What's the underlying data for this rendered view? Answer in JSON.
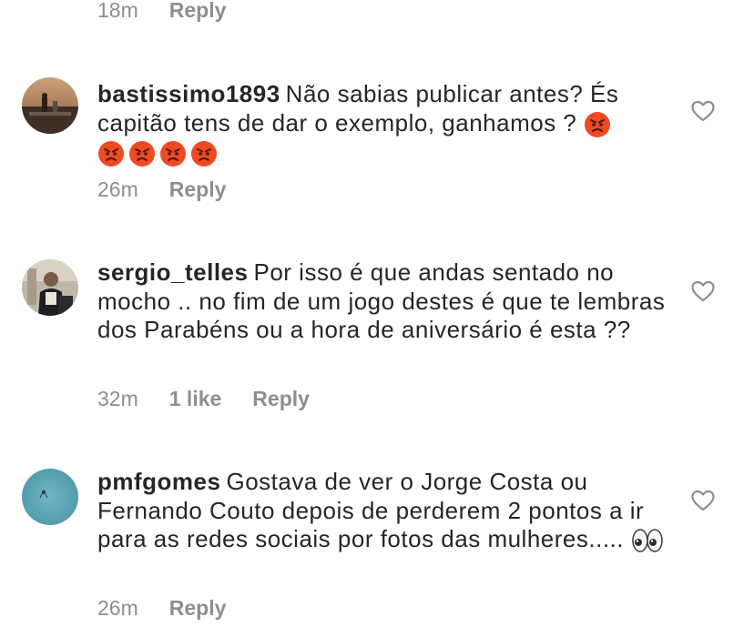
{
  "top_meta": {
    "time": "18m",
    "reply": "Reply"
  },
  "comments": [
    {
      "username": "bastissimo1893",
      "text": "Não sabias publicar antes? És capitão tens de dar o exemplo, ganhamos ?",
      "emojis": [
        "angry-face",
        "angry-face",
        "angry-face",
        "angry-face",
        "angry-face"
      ],
      "time": "26m",
      "likes": "",
      "reply": "Reply"
    },
    {
      "username": "sergio_telles",
      "text": "Por isso é que andas sentado no mocho .. no fim de um jogo destes é que te lembras dos Parabéns ou a hora de aniversário é esta ??",
      "time": "32m",
      "likes": "1 like",
      "reply": "Reply"
    },
    {
      "username": "pmfgomes",
      "text": "Gostava de ver o Jorge Costa ou Fernando Couto depois de perderem 2 pontos a ir para as redes sociais por fotos das mulheres.....",
      "emojis": [
        "eyes"
      ],
      "time": "26m",
      "likes": "",
      "reply": "Reply"
    }
  ],
  "colors": {
    "text": "#262626",
    "meta": "#8e8e8e",
    "heart_stroke": "#8e8e8e",
    "angry_face": "#f04a23"
  }
}
